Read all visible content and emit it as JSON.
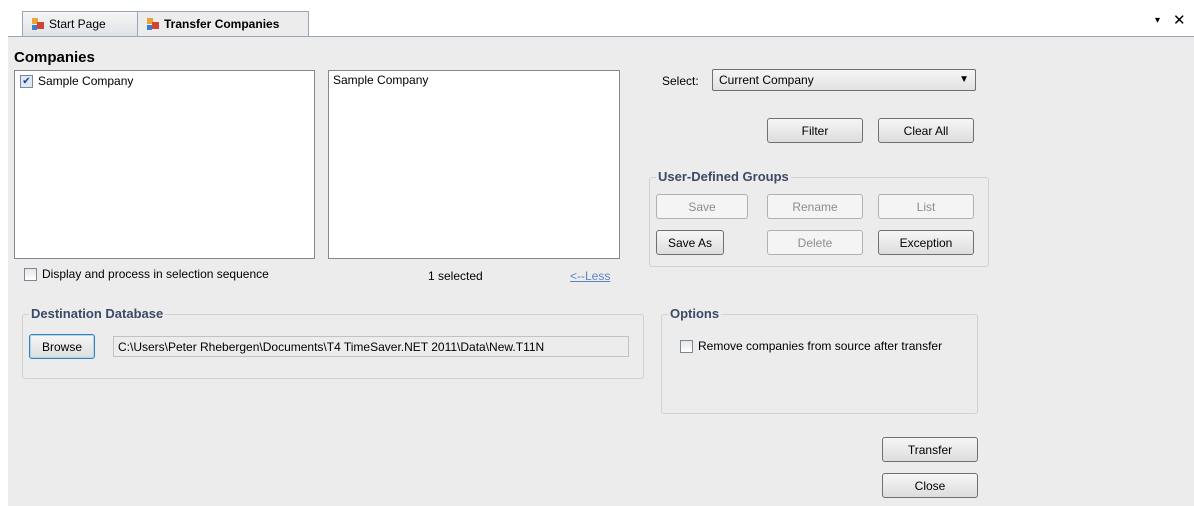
{
  "tabs": [
    {
      "label": "Start Page",
      "active": false
    },
    {
      "label": "Transfer Companies",
      "active": true
    }
  ],
  "tabstrip_controls": {
    "menu_icon": "▾",
    "close_icon": "✕"
  },
  "companies": {
    "heading": "Companies",
    "source_list": [
      {
        "label": "Sample Company",
        "checked": true
      }
    ],
    "selected_list": [
      "Sample Company"
    ],
    "sequence_checkbox_label": "Display and process in selection sequence",
    "sequence_checked": false,
    "selected_count_text": "1 selected",
    "less_link": "<--Less"
  },
  "select": {
    "label": "Select:",
    "value": "Current Company"
  },
  "filter_buttons": {
    "filter": "Filter",
    "clear_all": "Clear All"
  },
  "user_defined_groups": {
    "title": "User-Defined Groups",
    "buttons": {
      "save": "Save",
      "rename": "Rename",
      "list": "List",
      "save_as": "Save As",
      "delete": "Delete",
      "exception": "Exception"
    }
  },
  "destination": {
    "title": "Destination Database",
    "browse_label": "Browse",
    "path": "C:\\Users\\Peter Rhebergen\\Documents\\T4 TimeSaver.NET 2011\\Data\\New.T11N"
  },
  "options": {
    "title": "Options",
    "remove_label": "Remove companies from source after transfer",
    "remove_checked": false
  },
  "actions": {
    "transfer": "Transfer",
    "close": "Close"
  },
  "colors": {
    "panel_bg": "#ececec",
    "groupbox_title": "#3b4a66",
    "link": "#5b85c4",
    "check": "#1c3d8c"
  }
}
